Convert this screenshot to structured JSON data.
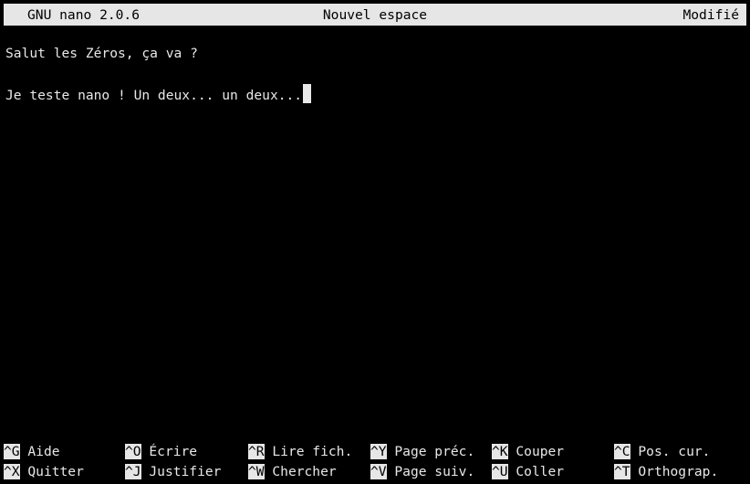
{
  "titlebar": {
    "app": "GNU nano 2.0.6",
    "buffer": "Nouvel espace",
    "status": "Modifié"
  },
  "editor": {
    "lines": [
      "Salut les Zéros, ça va ?",
      "",
      "Je teste nano ! Un deux... un deux..."
    ]
  },
  "shortcuts": {
    "row1": [
      {
        "key": "^G",
        "label": "Aide"
      },
      {
        "key": "^O",
        "label": "Écrire"
      },
      {
        "key": "^R",
        "label": "Lire fich."
      },
      {
        "key": "^Y",
        "label": "Page préc."
      },
      {
        "key": "^K",
        "label": "Couper"
      },
      {
        "key": "^C",
        "label": "Pos. cur."
      }
    ],
    "row2": [
      {
        "key": "^X",
        "label": "Quitter"
      },
      {
        "key": "^J",
        "label": "Justifier"
      },
      {
        "key": "^W",
        "label": "Chercher"
      },
      {
        "key": "^V",
        "label": "Page suiv."
      },
      {
        "key": "^U",
        "label": "Coller"
      },
      {
        "key": "^T",
        "label": "Orthograp."
      }
    ]
  },
  "colors": {
    "background": "#000000",
    "foreground": "#e8e8e8",
    "inverse_bg": "#e6e6e6"
  }
}
